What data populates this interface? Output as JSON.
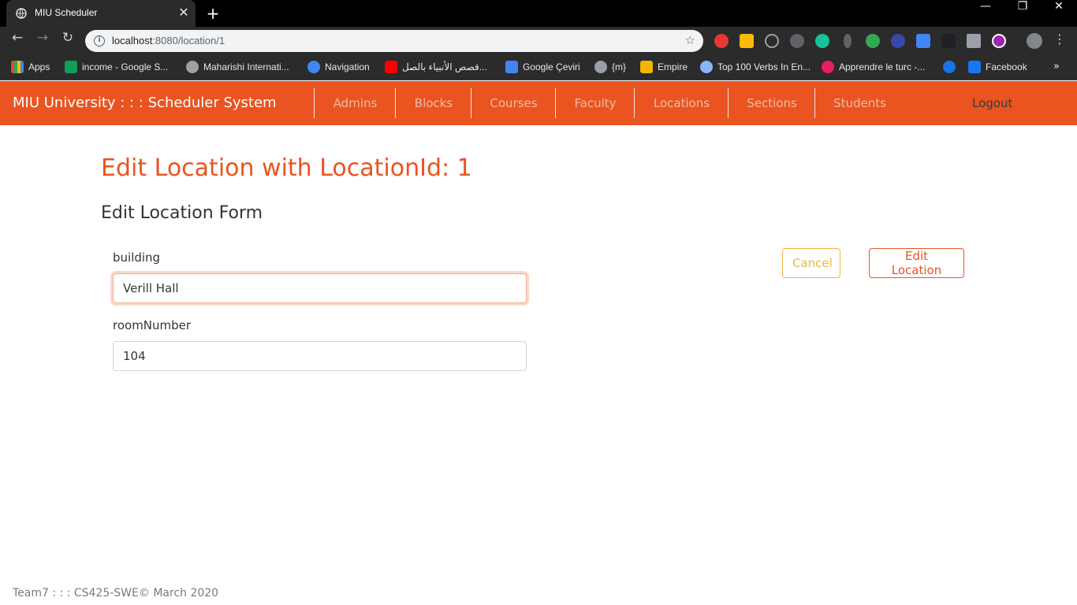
{
  "browser": {
    "tab_title": "MIU Scheduler",
    "tab_close": "✕",
    "new_tab": "+",
    "url_host": "localhost",
    "url_path": ":8080/location/1",
    "window_controls": {
      "minimize": "—",
      "maximize": "❐",
      "close": "✕"
    },
    "nav_icons": {
      "back": "←",
      "forward": "→",
      "reload": "↻",
      "star": "☆",
      "menu": "⋮",
      "more": "»"
    },
    "bookmarks": [
      {
        "label": "Apps",
        "icon": "apps-grid-icon",
        "color": "#4285f4"
      },
      {
        "label": "income - Google S...",
        "icon": "google-sheets-icon",
        "color": "#0f9d58"
      },
      {
        "label": "Maharishi Internati...",
        "icon": "globe-icon",
        "color": "#9aa0a6"
      },
      {
        "label": "Navigation",
        "icon": "navigation-icon",
        "color": "#4285f4"
      },
      {
        "label": "قصص الأنبياء بالصل...",
        "icon": "youtube-icon",
        "color": "#ff0000"
      },
      {
        "label": "Google Çeviri",
        "icon": "google-translate-icon",
        "color": "#4285f4"
      },
      {
        "label": "{m}",
        "icon": "globe-icon",
        "color": "#9aa0a6"
      },
      {
        "label": "Empire",
        "icon": "empire-icon",
        "color": "#f4b400"
      },
      {
        "label": "Top 100 Verbs In En...",
        "icon": "verbs-icon",
        "color": "#8ab4f8"
      },
      {
        "label": "Apprendre le turc -...",
        "icon": "language-icon",
        "color": "#e91e63"
      },
      {
        "label": "",
        "icon": "bookmark-logo-icon",
        "color": "#1a73e8"
      },
      {
        "label": "Facebook",
        "icon": "facebook-icon",
        "color": "#1877f2"
      }
    ]
  },
  "navbar": {
    "brand": "MIU University : : : Scheduler System",
    "items": [
      "Admins",
      "Blocks",
      "Courses",
      "Faculty",
      "Locations",
      "Sections",
      "Students"
    ],
    "logout": "Logout"
  },
  "page": {
    "title": "Edit Location with LocationId: 1",
    "form_title": "Edit Location Form",
    "fields": {
      "building": {
        "label": "building",
        "value": "Verill Hall"
      },
      "room_number": {
        "label": "roomNumber",
        "value": "104"
      }
    },
    "buttons": {
      "cancel": "Cancel",
      "submit": "Edit Location"
    }
  },
  "footer": {
    "text": "Team7 : : : CS425-SWE© March 2020"
  },
  "colors": {
    "brand_orange": "#e95420",
    "warning_yellow": "#efb73e",
    "chrome_dark": "#2b2b2b"
  }
}
